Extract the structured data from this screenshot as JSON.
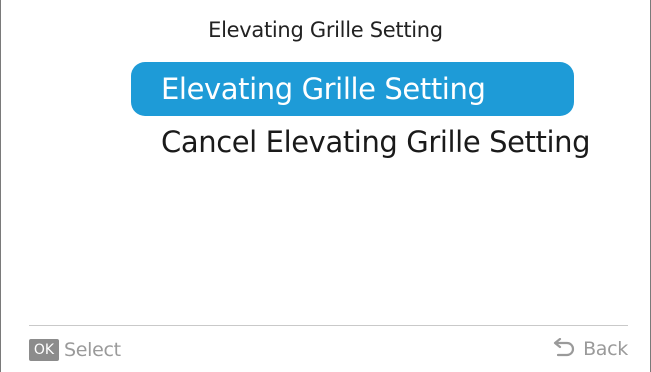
{
  "header": {
    "title": "Elevating Grille Setting"
  },
  "menu": {
    "items": [
      {
        "label": "Elevating Grille Setting",
        "selected": true
      },
      {
        "label": "Cancel Elevating Grille Setting",
        "selected": false
      }
    ]
  },
  "footer": {
    "ok_key": "OK",
    "select_label": "Select",
    "back_icon": "back-arrow-icon",
    "back_label": "Back"
  },
  "colors": {
    "selection_bg": "#1e9bd7",
    "selection_text": "#ffffff",
    "ok_key_bg": "#8c8c8c",
    "footer_text": "#9a9a9a"
  }
}
